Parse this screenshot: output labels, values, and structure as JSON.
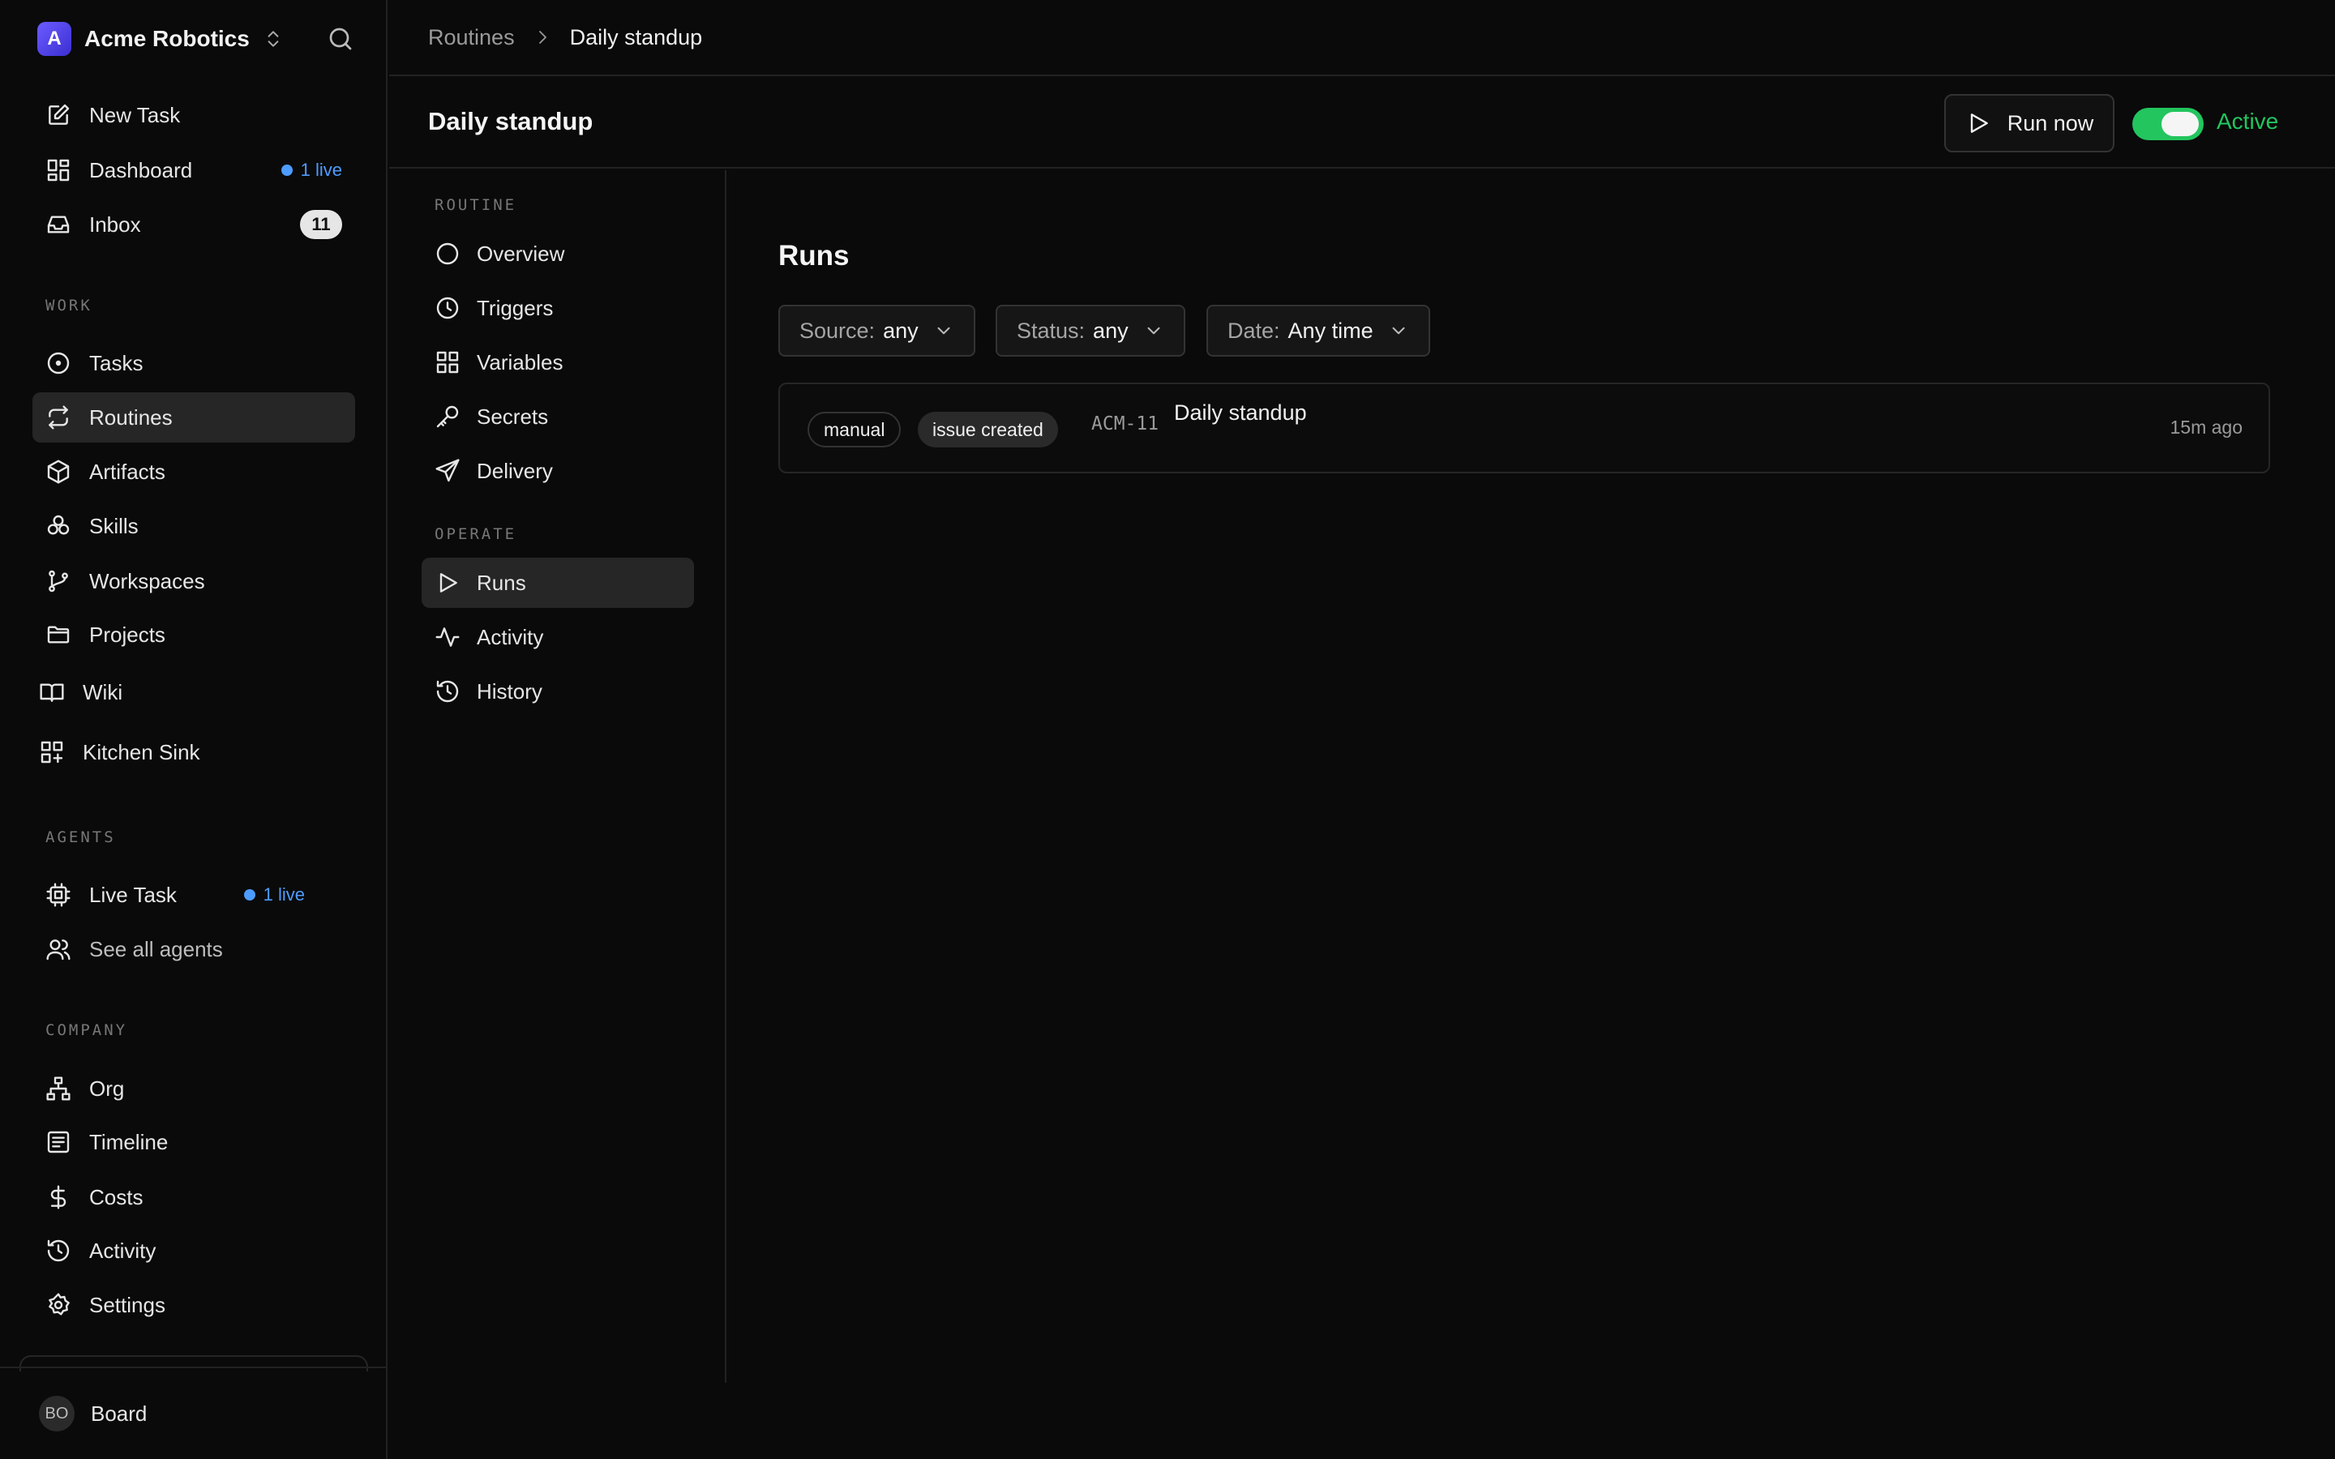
{
  "workspace": {
    "logo_letter": "A",
    "name": "Acme Robotics"
  },
  "sidebar": {
    "top_items": [
      {
        "label": "New Task",
        "icon": "edit-icon"
      },
      {
        "label": "Dashboard",
        "icon": "dashboard-icon",
        "live": "1 live"
      },
      {
        "label": "Inbox",
        "icon": "inbox-icon",
        "count": "11"
      }
    ],
    "sections": {
      "work": "WORK",
      "agents": "AGENTS",
      "company": "COMPANY"
    },
    "work_items": [
      {
        "label": "Tasks",
        "icon": "task-circle-icon"
      },
      {
        "label": "Routines",
        "icon": "repeat-icon",
        "active": true
      },
      {
        "label": "Artifacts",
        "icon": "box-icon"
      },
      {
        "label": "Skills",
        "icon": "skills-icon"
      },
      {
        "label": "Workspaces",
        "icon": "git-branch-icon"
      },
      {
        "label": "Projects",
        "icon": "folder-icon"
      },
      {
        "label": "Wiki",
        "icon": "book-icon"
      },
      {
        "label": "Kitchen Sink",
        "icon": "grid-plus-icon"
      }
    ],
    "agent_items": [
      {
        "label": "Live Task",
        "icon": "chip-icon",
        "live": "1 live"
      },
      {
        "label": "See all agents",
        "icon": "users-icon"
      }
    ],
    "company_items": [
      {
        "label": "Org",
        "icon": "org-icon"
      },
      {
        "label": "Timeline",
        "icon": "timeline-icon"
      },
      {
        "label": "Costs",
        "icon": "dollar-icon"
      },
      {
        "label": "Activity",
        "icon": "history-icon"
      },
      {
        "label": "Settings",
        "icon": "gear-icon"
      }
    ],
    "user": {
      "initials": "BO",
      "name": "Board"
    }
  },
  "breadcrumb": {
    "parent": "Routines",
    "current": "Daily standup"
  },
  "page": {
    "title": "Daily standup",
    "run_now_label": "Run now",
    "toggle_label": "Active",
    "toggle_on": true
  },
  "subnav": {
    "routine_label": "ROUTINE",
    "operate_label": "OPERATE",
    "routine_items": [
      "Overview",
      "Triggers",
      "Variables",
      "Secrets",
      "Delivery"
    ],
    "operate_items": [
      "Runs",
      "Activity",
      "History"
    ]
  },
  "runs": {
    "heading": "Runs",
    "filters": [
      {
        "key": "Source:",
        "value": "any"
      },
      {
        "key": "Status:",
        "value": "any"
      },
      {
        "key": "Date:",
        "value": "Any time"
      }
    ],
    "rows": [
      {
        "tags": [
          "manual",
          "issue created"
        ],
        "id": "ACM-11",
        "name": "Daily standup",
        "time": "15m ago"
      }
    ]
  },
  "colors": {
    "accent": "#4d9cff",
    "active_green": "#22c55e",
    "background": "#0a0a0a"
  }
}
